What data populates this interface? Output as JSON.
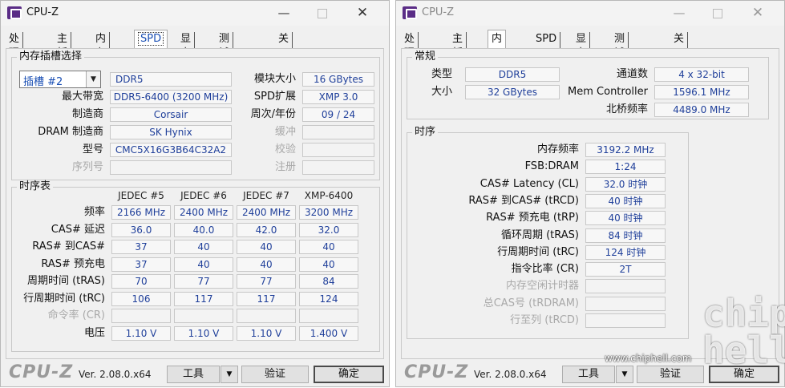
{
  "left": {
    "title": "CPU-Z",
    "tabs": [
      "处理器",
      "主板",
      "内存",
      "SPD",
      "显卡",
      "测试分数",
      "关于"
    ],
    "active_tab": "SPD",
    "slot_group_label": "内存插槽选择",
    "slot_select": "插槽 #2",
    "fields": {
      "type": "DDR5",
      "max_bandwidth_label": "最大带宽",
      "max_bandwidth": "DDR5-6400 (3200 MHz)",
      "manufacturer_label": "制造商",
      "manufacturer": "Corsair",
      "dram_label": "DRAM 制造商",
      "dram": "SK Hynix",
      "part_label": "型号",
      "part": "CMC5X16G3B64C32A2",
      "serial_label": "序列号",
      "serial": "",
      "module_size_label": "模块大小",
      "module_size": "16 GBytes",
      "spd_ext_label": "SPD扩展",
      "spd_ext": "XMP 3.0",
      "week_year_label": "周次/年份",
      "week_year": "09 / 24",
      "buffered_label": "缓冲",
      "buffered": "",
      "correction_label": "校验",
      "correction": "",
      "registered_label": "注册",
      "registered": ""
    },
    "timing_group_label": "时序表",
    "timing_headers": [
      "JEDEC #5",
      "JEDEC #6",
      "JEDEC #7",
      "XMP-6400"
    ],
    "timing_rows": [
      {
        "label": "频率",
        "values": [
          "2166 MHz",
          "2400 MHz",
          "2400 MHz",
          "3200 MHz"
        ]
      },
      {
        "label": "CAS# 延迟",
        "values": [
          "36.0",
          "40.0",
          "42.0",
          "32.0"
        ]
      },
      {
        "label": "RAS# 到CAS#",
        "values": [
          "37",
          "40",
          "40",
          "40"
        ]
      },
      {
        "label": "RAS# 预充电",
        "values": [
          "37",
          "40",
          "40",
          "40"
        ]
      },
      {
        "label": "周期时间 (tRAS)",
        "values": [
          "70",
          "77",
          "77",
          "84"
        ]
      },
      {
        "label": "行周期时间 (tRC)",
        "values": [
          "106",
          "117",
          "117",
          "124"
        ]
      },
      {
        "label": "命令率 (CR)",
        "values": [
          "",
          "",
          "",
          ""
        ]
      },
      {
        "label": "电压",
        "values": [
          "1.10 V",
          "1.10 V",
          "1.10 V",
          "1.400 V"
        ]
      }
    ],
    "footer": {
      "brand": "CPU-Z",
      "version": "Ver. 2.08.0.x64",
      "tools": "工具",
      "validate": "验证",
      "ok": "确定"
    }
  },
  "right": {
    "title": "CPU-Z",
    "tabs": [
      "处理器",
      "主板",
      "内存",
      "SPD",
      "显卡",
      "测试分数",
      "关于"
    ],
    "active_tab": "内存",
    "general_label": "常规",
    "general": {
      "type_label": "类型",
      "type": "DDR5",
      "size_label": "大小",
      "size": "32 GBytes",
      "channels_label": "通道数",
      "channels": "4 x 32-bit",
      "mc_label": "Mem Controller",
      "mc": "1596.1 MHz",
      "nb_label": "北桥频率",
      "nb": "4489.0 MHz"
    },
    "timings_label": "时序",
    "timings": [
      {
        "label": "内存频率",
        "value": "3192.2 MHz"
      },
      {
        "label": "FSB:DRAM",
        "value": "1:24"
      },
      {
        "label": "CAS# Latency (CL)",
        "value": "32.0 时钟"
      },
      {
        "label": "RAS# 到CAS# (tRCD)",
        "value": "40 时钟"
      },
      {
        "label": "RAS# 预充电 (tRP)",
        "value": "40 时钟"
      },
      {
        "label": "循环周期 (tRAS)",
        "value": "84 时钟"
      },
      {
        "label": "行周期时间 (tRC)",
        "value": "124 时钟"
      },
      {
        "label": "指令比率 (CR)",
        "value": "2T"
      },
      {
        "label": "内存空闲计时器",
        "value": ""
      },
      {
        "label": "总CAS号 (tRDRAM)",
        "value": ""
      },
      {
        "label": "行至列 (tRCD)",
        "value": ""
      }
    ],
    "footer": {
      "brand": "CPU-Z",
      "version": "Ver. 2.08.0.x64",
      "tools": "工具",
      "validate": "验证",
      "ok": "确定"
    }
  },
  "watermark": {
    "url": "www.chiphell.com",
    "logo": "chip hell"
  }
}
